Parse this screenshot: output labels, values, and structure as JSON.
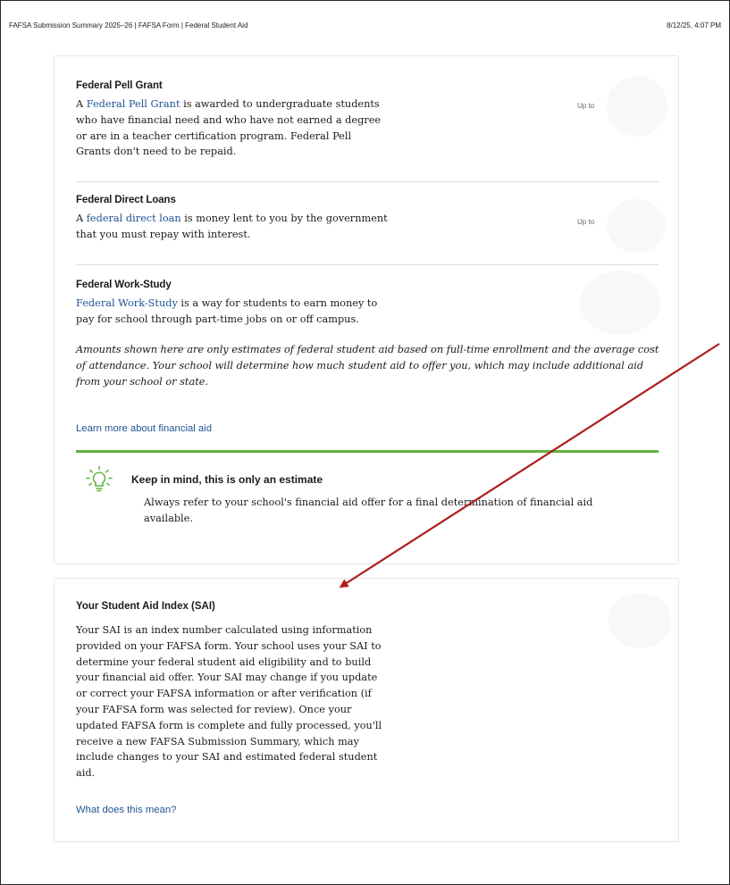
{
  "print_header": {
    "title": "FAFSA Submission Summary 2025–26 | FAFSA Form | Federal Student Aid",
    "date": "8/12/25, 4:07 PM"
  },
  "aid_sections": [
    {
      "heading": "Federal Pell Grant",
      "body_prefix": "A ",
      "link": "Federal Pell Grant",
      "body_suffix": " is awarded to undergraduate students who have financial need and who have not earned a degree or are in a teacher certification program. Federal Pell Grants don't need to be repaid.",
      "amount_label": "Up to"
    },
    {
      "heading": "Federal Direct Loans",
      "body_prefix": "A ",
      "link": "federal direct loan",
      "body_suffix": " is money lent to you by the government that you must repay with interest.",
      "amount_label": "Up to"
    },
    {
      "heading": "Federal Work-Study",
      "body_prefix": "",
      "link": "Federal Work-Study",
      "body_suffix": " is a way for students to earn money to pay for school through part-time jobs on or off campus.",
      "amount_label": ""
    }
  ],
  "disclaimer": "Amounts shown here are only estimates of federal student aid based on full-time enrollment and the average cost of attendance. Your school will determine how much student aid to offer you, which may include additional aid from your school or state.",
  "learn_more_link": "Learn more about financial aid",
  "tip": {
    "icon": "lightbulb-icon",
    "heading": "Keep in mind, this is only an estimate",
    "body": "Always refer to your school's financial aid offer for a final determination of financial aid available."
  },
  "sai": {
    "heading": "Your Student Aid Index (SAI)",
    "body": "Your SAI is an index number calculated using information provided on your FAFSA form. Your school uses your SAI to determine your federal student aid eligibility and to build your financial aid offer. Your SAI may change if you update or correct your FAFSA information or after verification (if your FAFSA form was selected for review). Once your updated FAFSA form is complete and fully processed, you'll receive a new FAFSA Submission Summary, which may include changes to your SAI and estimated federal student aid.",
    "link": "What does this mean?"
  },
  "colors": {
    "link": "#205493",
    "accent_green": "#5fb33f",
    "annotation_arrow": "#b01c1c"
  }
}
